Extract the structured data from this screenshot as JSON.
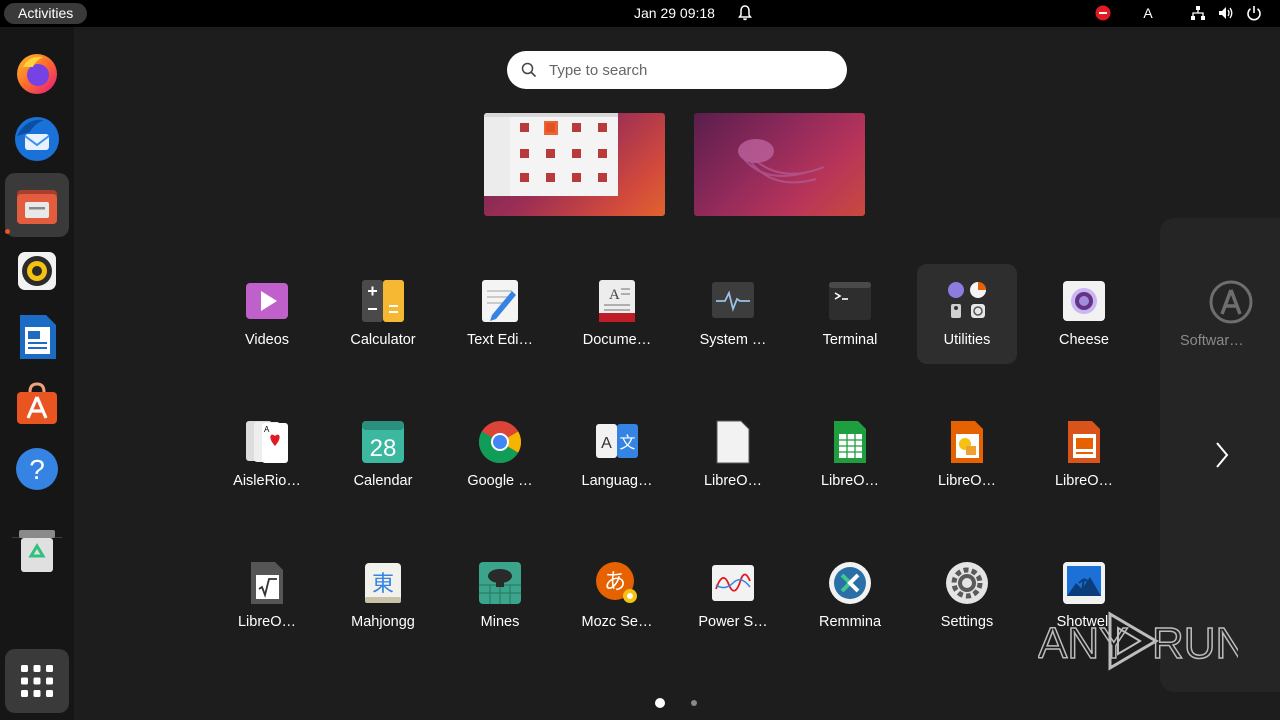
{
  "topbar": {
    "activities": "Activities",
    "clock": "Jan 29  09:18",
    "keyboard_layout": "A"
  },
  "search": {
    "placeholder": "Type to search"
  },
  "dock": [
    "Firefox",
    "Thunderbird Mail",
    "Files",
    "Rhythmbox",
    "LibreOffice Writer",
    "Ubuntu Software",
    "Help",
    "Trash",
    "Show Applications"
  ],
  "apps": [
    {
      "label": "Videos"
    },
    {
      "label": "Calculator"
    },
    {
      "label": "Text Edi…"
    },
    {
      "label": "Docume…"
    },
    {
      "label": "System …"
    },
    {
      "label": "Terminal"
    },
    {
      "label": "Utilities"
    },
    {
      "label": "Cheese"
    },
    {
      "label": "AisleRio…"
    },
    {
      "label": "Calendar"
    },
    {
      "label": "Google …"
    },
    {
      "label": "Languag…"
    },
    {
      "label": "LibreO…"
    },
    {
      "label": "LibreO…"
    },
    {
      "label": "LibreO…"
    },
    {
      "label": "LibreO…"
    },
    {
      "label": "LibreO…"
    },
    {
      "label": "Mahjongg"
    },
    {
      "label": "Mines"
    },
    {
      "label": "Mozc Se…"
    },
    {
      "label": "Power S…"
    },
    {
      "label": "Remmina"
    },
    {
      "label": "Settings"
    },
    {
      "label": "Shotwell"
    }
  ],
  "next_page_app": {
    "label": "Softwar…"
  },
  "pagination": {
    "current": 1,
    "total": 2
  },
  "watermark": {
    "left": "ANY",
    "right": "RUN"
  },
  "colors": {
    "accent": "#e95420",
    "topbar": "#000000",
    "dock": "#161616",
    "background": "#1d1d1d"
  }
}
